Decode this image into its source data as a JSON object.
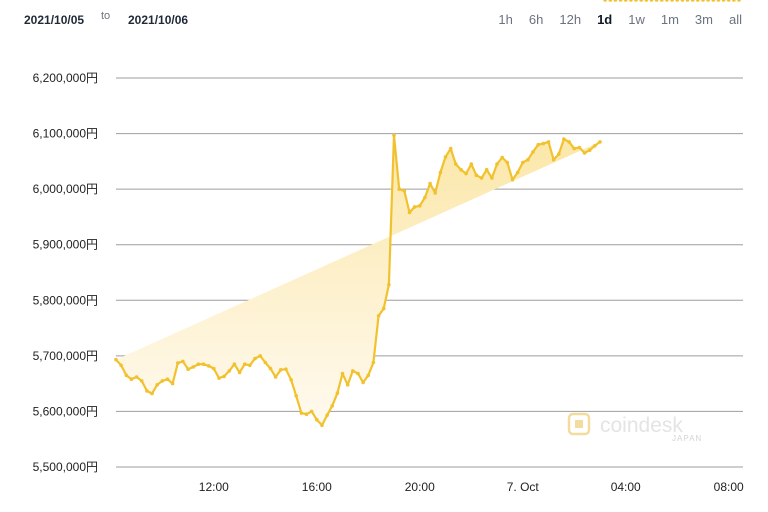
{
  "range": {
    "start_date": "2021/10/05",
    "to_label": "to",
    "end_date": "2021/10/06",
    "options": [
      "1h",
      "6h",
      "12h",
      "1d",
      "1w",
      "1m",
      "3m",
      "all"
    ],
    "selected": "1d"
  },
  "watermark": {
    "brand": "coindesk",
    "sub": "JAPAN"
  },
  "colors": {
    "line": "#f2c12e",
    "fill_top": "#fbe7a8",
    "fill_bottom": "#fffaf0",
    "grid": "#9e9e9e"
  },
  "chart_data": {
    "type": "area",
    "title": "",
    "xlabel": "",
    "ylabel": "",
    "ylim": [
      5500000,
      6200000
    ],
    "y_ticks": [
      "5,500,000円",
      "5,600,000円",
      "5,700,000円",
      "5,800,000円",
      "5,900,000円",
      "6,000,000円",
      "6,100,000円",
      "6,200,000円"
    ],
    "y_tick_values": [
      5500000,
      5600000,
      5700000,
      5800000,
      5900000,
      6000000,
      6100000,
      6200000
    ],
    "x_ticks": [
      "12:00",
      "16:00",
      "20:00",
      "7. Oct",
      "04:00",
      "08:00"
    ],
    "x_tick_hours": [
      12,
      16,
      20,
      24,
      28,
      32
    ],
    "grid": true,
    "series": [
      {
        "x_hours": [
          8.2,
          8.4,
          8.6,
          8.8,
          9.0,
          9.2,
          9.4,
          9.6,
          9.8,
          10.0,
          10.2,
          10.4,
          10.6,
          10.8,
          11.0,
          11.2,
          11.4,
          11.6,
          11.8,
          12.0,
          12.2,
          12.4,
          12.6,
          12.8,
          13.0,
          13.2,
          13.4,
          13.6,
          13.8,
          14.0,
          14.2,
          14.4,
          14.6,
          14.8,
          15.0,
          15.2,
          15.4,
          15.6,
          15.8,
          16.0,
          16.2,
          16.4,
          16.6,
          16.8,
          17.0,
          17.2,
          17.4,
          17.6,
          17.8,
          18.0,
          18.2,
          18.4,
          18.6,
          18.8,
          19.0,
          19.2,
          19.4,
          19.6,
          19.8,
          20.0,
          20.2,
          20.4,
          20.6,
          20.8,
          21.0,
          21.2,
          21.4,
          21.6,
          21.8,
          22.0,
          22.2,
          22.4,
          22.6,
          22.8,
          23.0,
          23.2,
          23.4,
          23.6,
          23.8,
          24.0,
          24.2,
          24.4,
          24.6,
          24.8,
          25.0,
          25.2,
          25.4,
          25.6,
          25.8,
          26.0,
          26.2,
          26.4,
          26.6,
          26.8,
          27.0,
          27.2,
          27.4,
          27.6,
          27.8,
          28.0,
          28.2,
          28.4,
          28.6,
          28.8,
          29.0,
          29.2,
          29.4,
          29.6,
          29.8,
          30.0,
          30.2,
          30.4,
          30.6,
          30.8,
          31.0,
          31.2,
          31.4,
          31.6,
          31.8,
          32.0,
          32.2,
          32.4
        ],
        "values": [
          5693000,
          5683000,
          5665000,
          5658000,
          5662000,
          5655000,
          5637000,
          5632000,
          5648000,
          5655000,
          5658000,
          5650000,
          5687000,
          5690000,
          5676000,
          5680000,
          5685000,
          5685000,
          5682000,
          5677000,
          5660000,
          5663000,
          5673000,
          5685000,
          5670000,
          5685000,
          5683000,
          5695000,
          5700000,
          5688000,
          5677000,
          5662000,
          5675000,
          5676000,
          5657000,
          5628000,
          5597000,
          5595000,
          5600000,
          5585000,
          5575000,
          5593000,
          5610000,
          5633000,
          5668000,
          5648000,
          5673000,
          5668000,
          5652000,
          5665000,
          5688000,
          5772000,
          5785000,
          5828000,
          6097000,
          6000000,
          5997000,
          5958000,
          5968000,
          5970000,
          5985000,
          6010000,
          5993000,
          6030000,
          6058000,
          6073000,
          6045000,
          6035000,
          6028000,
          6045000,
          6025000,
          6020000,
          6035000,
          6020000,
          6045000,
          6057000,
          6048000,
          6017000,
          6030000,
          6048000,
          6053000,
          6067000,
          6080000,
          6082000,
          6085000,
          6053000,
          6063000,
          6090000,
          6085000,
          6073000,
          6075000,
          6065000,
          6070000,
          6078000,
          6085000
        ]
      }
    ]
  }
}
